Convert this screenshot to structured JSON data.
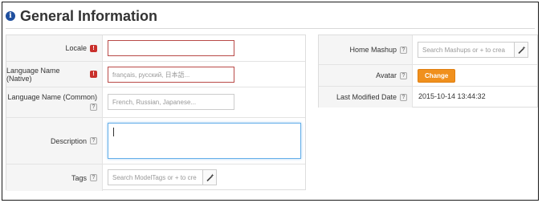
{
  "section": {
    "title": "General Information",
    "icon": "info-icon"
  },
  "left_form": {
    "locale": {
      "label": "Locale",
      "value": "",
      "required": true
    },
    "language_native": {
      "label": "Language Name (Native)",
      "placeholder": "français, русский, 日本語...",
      "required": true
    },
    "language_common": {
      "label": "Language Name (Common)",
      "placeholder": "French, Russian, Japanese..."
    },
    "description": {
      "label": "Description",
      "value": ""
    },
    "tags": {
      "label": "Tags",
      "placeholder": "Search ModelTags or + to cre"
    }
  },
  "right_form": {
    "home_mashup": {
      "label": "Home Mashup",
      "placeholder": "Search Mashups or + to crea"
    },
    "avatar": {
      "label": "Avatar",
      "button": "Change"
    },
    "last_modified": {
      "label": "Last Modified Date",
      "value": "2015-10-14 13:44:32"
    }
  },
  "symbols": {
    "help": "?",
    "required": "!"
  },
  "colors": {
    "accent_orange": "#f0901d",
    "required_red": "#c9302c",
    "info_blue": "#1f4f9e",
    "focus_blue": "#66afe9"
  }
}
